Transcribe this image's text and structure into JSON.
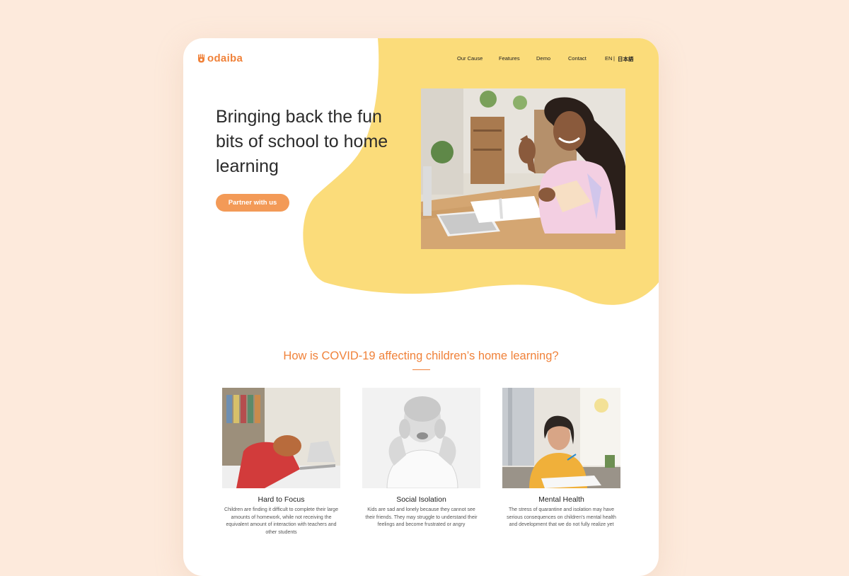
{
  "brand": {
    "name": "odaiba",
    "logo_icon": "odaiba-hand-logo",
    "accent": "#f0823a",
    "blob": "#fbdc7a"
  },
  "nav": {
    "items": [
      "Our Cause",
      "Features",
      "Demo",
      "Contact"
    ],
    "lang_en": "EN",
    "lang_sep": "|",
    "lang_jp": "日本語"
  },
  "hero": {
    "title": "Bringing back the fun bits of school to home learning",
    "cta": "Partner with us",
    "image": "girl-waving-at-laptop-photo"
  },
  "section": {
    "title": "How is COVID-19 affecting children’s home learning?",
    "cards": [
      {
        "title": "Hard to Focus",
        "text": "Children are finding it difficult to complete their large amounts of homework, while not receiving the equivalent amount of interaction with teachers and other students",
        "image": "tired-student-on-desk-photo"
      },
      {
        "title": "Social Isolation",
        "text": "Kids are sad and lonely because they cannot see their friends. They may struggle to understand their feelings and become frustrated or angry",
        "image": "crying-boy-photo"
      },
      {
        "title": "Mental Health",
        "text": "The stress of quarantine and isolation may have serious consequences on children’s mental health and development that we do not fully realize yet",
        "image": "stressed-girl-studying-photo"
      }
    ]
  }
}
